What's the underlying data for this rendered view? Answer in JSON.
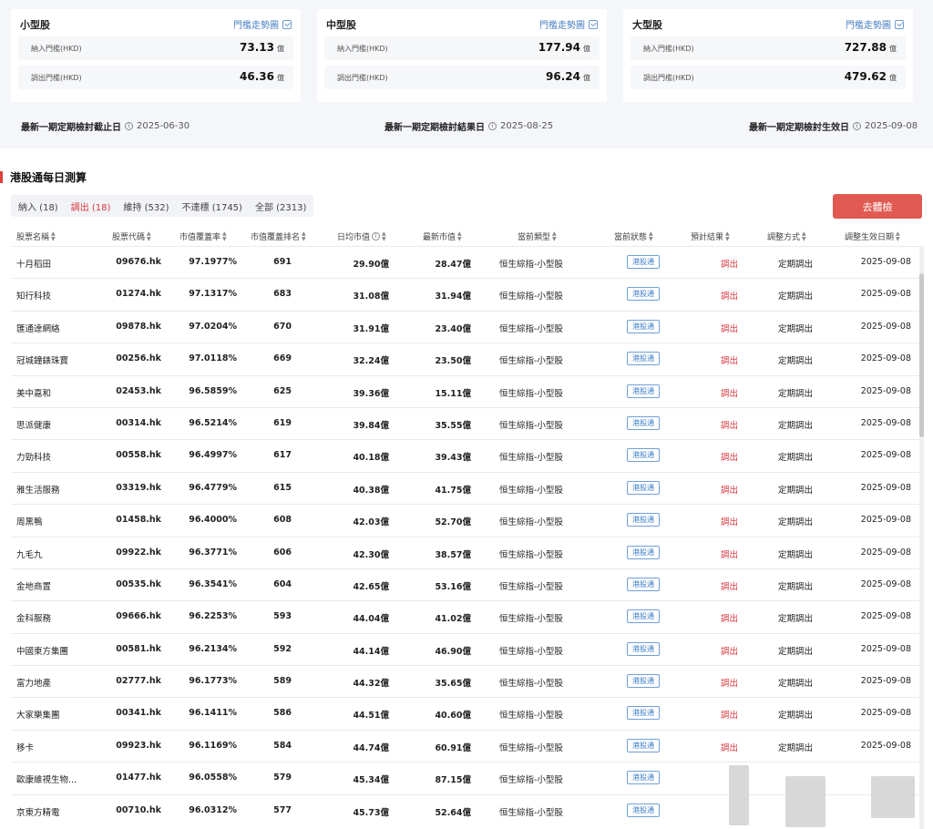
{
  "threshold_cards": [
    {
      "title": "小型股",
      "link": "門檻走勢圖",
      "in_label": "納入門檻(HKD)",
      "in_value": "73.13",
      "out_label": "調出門檻(HKD)",
      "out_value": "46.36",
      "unit": "億"
    },
    {
      "title": "中型股",
      "link": "門檻走勢圖",
      "in_label": "納入門檻(HKD)",
      "in_value": "177.94",
      "out_label": "調出門檻(HKD)",
      "out_value": "96.24",
      "unit": "億"
    },
    {
      "title": "大型股",
      "link": "門檻走勢圖",
      "in_label": "納入門檻(HKD)",
      "in_value": "727.88",
      "out_label": "調出門檻(HKD)",
      "out_value": "479.62",
      "unit": "億"
    }
  ],
  "review": {
    "cutoff_label": "最新一期定期檢討截止日",
    "cutoff_date": "2025-06-30",
    "result_label": "最新一期定期檢討結果日",
    "result_date": "2025-08-25",
    "effective_label": "最新一期定期檢討生效日",
    "effective_date": "2025-09-08"
  },
  "section_title": "港股通每日測算",
  "tabs": [
    {
      "label": "納入 (18)",
      "active": false
    },
    {
      "label": "調出 (18)",
      "active": true
    },
    {
      "label": "維持 (532)",
      "active": false
    },
    {
      "label": "不達標 (1745)",
      "active": false
    },
    {
      "label": "全部 (2313)",
      "active": false
    }
  ],
  "check_button": "去體檢",
  "columns": [
    "股票名稱",
    "股票代碼",
    "市值覆蓋率",
    "市值覆蓋排名",
    "日均市值",
    "最新市值",
    "當前類型",
    "當前狀態",
    "預計結果",
    "調整方式",
    "調整生效日期"
  ],
  "rows": [
    {
      "name": "十月稻田",
      "code": "09676.hk",
      "rate": "97.1977%",
      "rank": "691",
      "avg": "29.90億",
      "latest": "28.47億",
      "cat": "恒生綜指-小型股",
      "status": "港股通",
      "result": "調出",
      "method": "定期調出",
      "date": "2025-09-08"
    },
    {
      "name": "知行科技",
      "code": "01274.hk",
      "rate": "97.1317%",
      "rank": "683",
      "avg": "31.08億",
      "latest": "31.94億",
      "cat": "恒生綜指-小型股",
      "status": "港股通",
      "result": "調出",
      "method": "定期調出",
      "date": "2025-09-08"
    },
    {
      "name": "匯通達網絡",
      "code": "09878.hk",
      "rate": "97.0204%",
      "rank": "670",
      "avg": "31.91億",
      "latest": "23.40億",
      "cat": "恒生綜指-小型股",
      "status": "港股通",
      "result": "調出",
      "method": "定期調出",
      "date": "2025-09-08"
    },
    {
      "name": "冠城鐘錶珠寶",
      "code": "00256.hk",
      "rate": "97.0118%",
      "rank": "669",
      "avg": "32.24億",
      "latest": "23.50億",
      "cat": "恒生綜指-小型股",
      "status": "港股通",
      "result": "調出",
      "method": "定期調出",
      "date": "2025-09-08"
    },
    {
      "name": "美中嘉和",
      "code": "02453.hk",
      "rate": "96.5859%",
      "rank": "625",
      "avg": "39.36億",
      "latest": "15.11億",
      "cat": "恒生綜指-小型股",
      "status": "港股通",
      "result": "調出",
      "method": "定期調出",
      "date": "2025-09-08"
    },
    {
      "name": "思派健康",
      "code": "00314.hk",
      "rate": "96.5214%",
      "rank": "619",
      "avg": "39.84億",
      "latest": "35.55億",
      "cat": "恒生綜指-小型股",
      "status": "港股通",
      "result": "調出",
      "method": "定期調出",
      "date": "2025-09-08"
    },
    {
      "name": "力勁科技",
      "code": "00558.hk",
      "rate": "96.4997%",
      "rank": "617",
      "avg": "40.18億",
      "latest": "39.43億",
      "cat": "恒生綜指-小型股",
      "status": "港股通",
      "result": "調出",
      "method": "定期調出",
      "date": "2025-09-08"
    },
    {
      "name": "雅生活服務",
      "code": "03319.hk",
      "rate": "96.4779%",
      "rank": "615",
      "avg": "40.38億",
      "latest": "41.75億",
      "cat": "恒生綜指-小型股",
      "status": "港股通",
      "result": "調出",
      "method": "定期調出",
      "date": "2025-09-08"
    },
    {
      "name": "周黑鴨",
      "code": "01458.hk",
      "rate": "96.4000%",
      "rank": "608",
      "avg": "42.03億",
      "latest": "52.70億",
      "cat": "恒生綜指-小型股",
      "status": "港股通",
      "result": "調出",
      "method": "定期調出",
      "date": "2025-09-08"
    },
    {
      "name": "九毛九",
      "code": "09922.hk",
      "rate": "96.3771%",
      "rank": "606",
      "avg": "42.30億",
      "latest": "38.57億",
      "cat": "恒生綜指-小型股",
      "status": "港股通",
      "result": "調出",
      "method": "定期調出",
      "date": "2025-09-08"
    },
    {
      "name": "金地商置",
      "code": "00535.hk",
      "rate": "96.3541%",
      "rank": "604",
      "avg": "42.65億",
      "latest": "53.16億",
      "cat": "恒生綜指-小型股",
      "status": "港股通",
      "result": "調出",
      "method": "定期調出",
      "date": "2025-09-08"
    },
    {
      "name": "金科服務",
      "code": "09666.hk",
      "rate": "96.2253%",
      "rank": "593",
      "avg": "44.04億",
      "latest": "41.02億",
      "cat": "恒生綜指-小型股",
      "status": "港股通",
      "result": "調出",
      "method": "定期調出",
      "date": "2025-09-08"
    },
    {
      "name": "中國東方集團",
      "code": "00581.hk",
      "rate": "96.2134%",
      "rank": "592",
      "avg": "44.14億",
      "latest": "46.90億",
      "cat": "恒生綜指-小型股",
      "status": "港股通",
      "result": "調出",
      "method": "定期調出",
      "date": "2025-09-08"
    },
    {
      "name": "富力地產",
      "code": "02777.hk",
      "rate": "96.1773%",
      "rank": "589",
      "avg": "44.32億",
      "latest": "35.65億",
      "cat": "恒生綜指-小型股",
      "status": "港股通",
      "result": "調出",
      "method": "定期調出",
      "date": "2025-09-08"
    },
    {
      "name": "大家樂集團",
      "code": "00341.hk",
      "rate": "96.1411%",
      "rank": "586",
      "avg": "44.51億",
      "latest": "40.60億",
      "cat": "恒生綜指-小型股",
      "status": "港股通",
      "result": "調出",
      "method": "定期調出",
      "date": "2025-09-08"
    },
    {
      "name": "移卡",
      "code": "09923.hk",
      "rate": "96.1169%",
      "rank": "584",
      "avg": "44.74億",
      "latest": "60.91億",
      "cat": "恒生綜指-小型股",
      "status": "港股通",
      "result": "調出",
      "method": "定期調出",
      "date": "2025-09-08"
    },
    {
      "name": "歐康維視生物...",
      "code": "01477.hk",
      "rate": "96.0558%",
      "rank": "579",
      "avg": "45.34億",
      "latest": "87.15億",
      "cat": "恒生綜指-小型股",
      "status": "港股通",
      "result": "",
      "method": "",
      "date": ""
    },
    {
      "name": "京東方精電",
      "code": "00710.hk",
      "rate": "96.0312%",
      "rank": "577",
      "avg": "45.73億",
      "latest": "52.64億",
      "cat": "恒生綜指-小型股",
      "status": "港股通",
      "result": "",
      "method": "",
      "date": ""
    }
  ]
}
